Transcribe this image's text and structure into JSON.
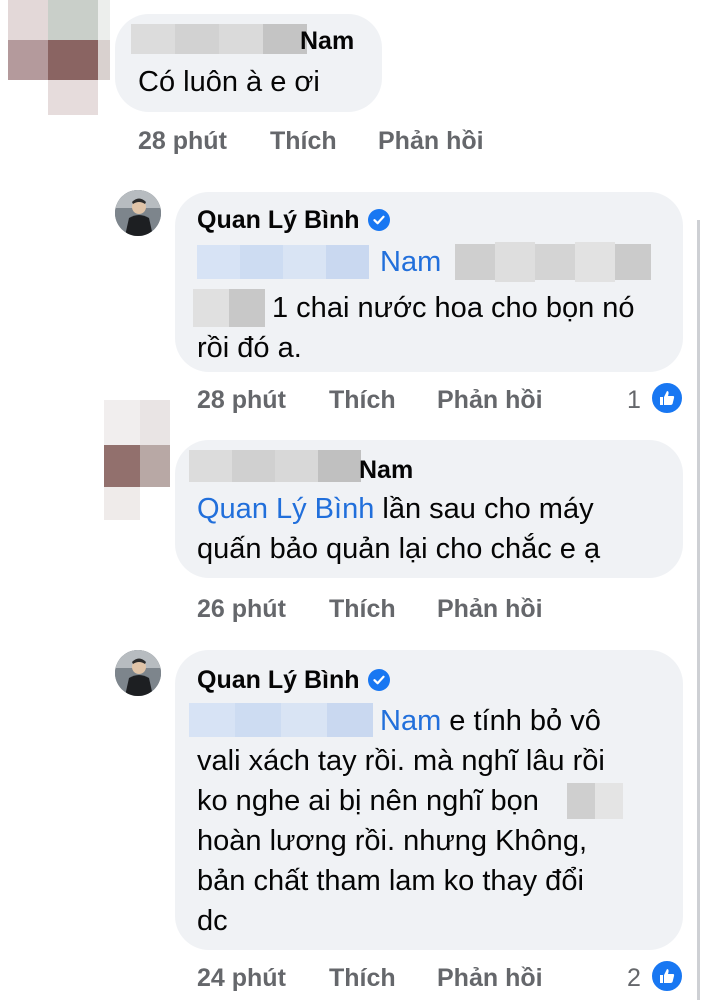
{
  "comments": [
    {
      "author_suffix": "Nam",
      "text": "Có luôn à e ơi",
      "time": "28 phút",
      "like_label": "Thích",
      "reply_label": "Phản hồi"
    },
    {
      "author": "Quan Lý Bình",
      "mention_suffix": "Nam",
      "line1": "1 chai nước hoa cho bọn nó",
      "line2": "rồi đó a.",
      "time": "28 phút",
      "like_label": "Thích",
      "reply_label": "Phản hồi",
      "reaction_count": "1"
    },
    {
      "author_suffix": "Nam",
      "mention": "Quan Lý Bình",
      "line1_rest": " lần sau cho máy",
      "line2": "quấn bảo quản lại cho chắc e ạ",
      "time": "26 phút",
      "like_label": "Thích",
      "reply_label": "Phản hồi"
    },
    {
      "author": "Quan Lý Bình",
      "mention_suffix": "Nam",
      "line1_rest": " e tính bỏ vô",
      "line2": "vali xách tay rồi. mà nghĩ lâu rồi",
      "line3": "ko nghe ai bị nên nghĩ bọn",
      "line4": "hoàn lương rồi. nhưng Không,",
      "line5": "bản chất tham lam ko thay đổi",
      "line6": "dc",
      "time": "24 phút",
      "like_label": "Thích",
      "reply_label": "Phản hồi",
      "reaction_count": "2"
    }
  ],
  "colors": {
    "bubble": "#f0f2f5",
    "mention": "#216fdb",
    "meta": "#65676b",
    "like_blue": "#1877f2"
  },
  "icons": [
    "verified-badge-icon",
    "like-reaction-icon"
  ]
}
